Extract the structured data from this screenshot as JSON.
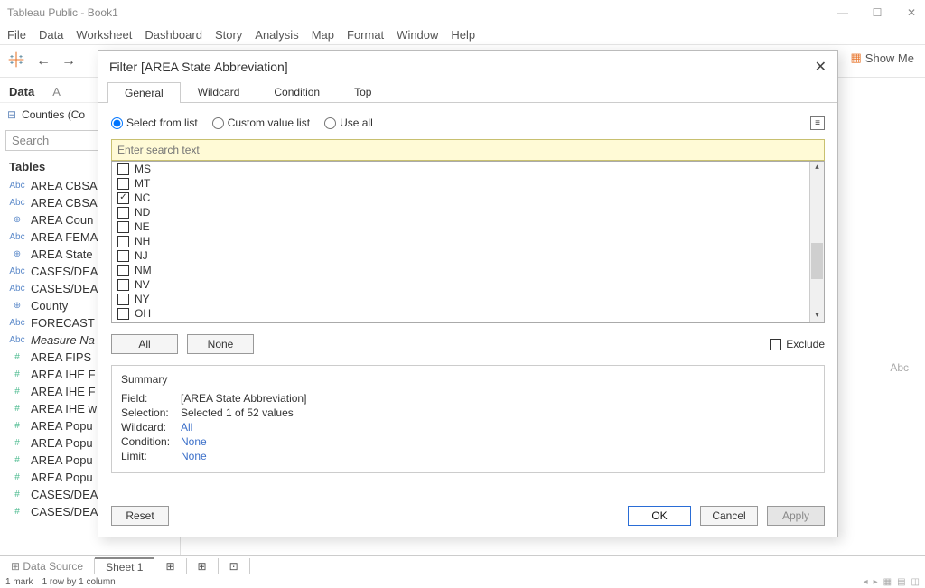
{
  "app": {
    "title": "Tableau Public - Book1"
  },
  "menu": [
    "File",
    "Data",
    "Worksheet",
    "Dashboard",
    "Story",
    "Analysis",
    "Map",
    "Format",
    "Window",
    "Help"
  ],
  "showme": "Show Me",
  "datapane": {
    "tab_data": "Data",
    "tab_analytics_initial": "A",
    "datasource": "Counties (Co",
    "search_placeholder": "Search",
    "tables_label": "Tables"
  },
  "fields": [
    {
      "type": "Abc",
      "label": "AREA CBSA",
      "measure": false
    },
    {
      "type": "Abc",
      "label": "AREA CBSA",
      "measure": false
    },
    {
      "type": "⊕",
      "label": "AREA Coun",
      "measure": false
    },
    {
      "type": "Abc",
      "label": "AREA FEMA",
      "measure": false
    },
    {
      "type": "⊕",
      "label": "AREA State",
      "measure": false
    },
    {
      "type": "Abc",
      "label": "CASES/DEA",
      "measure": false
    },
    {
      "type": "Abc",
      "label": "CASES/DEA",
      "measure": false
    },
    {
      "type": "⊕",
      "label": "County",
      "measure": false
    },
    {
      "type": "Abc",
      "label": "FORECAST",
      "measure": false
    },
    {
      "type": "Abc",
      "label": "Measure Na",
      "measure": false,
      "italic": true
    },
    {
      "type": "#",
      "label": "AREA FIPS ",
      "measure": true
    },
    {
      "type": "#",
      "label": "AREA IHE F",
      "measure": true
    },
    {
      "type": "#",
      "label": "AREA IHE F",
      "measure": true
    },
    {
      "type": "#",
      "label": "AREA IHE w",
      "measure": true
    },
    {
      "type": "#",
      "label": "AREA Popu",
      "measure": true
    },
    {
      "type": "#",
      "label": "AREA Popu",
      "measure": true
    },
    {
      "type": "#",
      "label": "AREA Popu",
      "measure": true
    },
    {
      "type": "#",
      "label": "AREA Popu",
      "measure": true
    },
    {
      "type": "#",
      "label": "CASES/DEA",
      "measure": true
    },
    {
      "type": "#",
      "label": "CASES/DEA",
      "measure": true
    }
  ],
  "bottom": {
    "datasource_tab": "Data Source",
    "sheet_tab": "Sheet 1"
  },
  "status": {
    "marks": "1 mark",
    "rows": "1 row by 1 column"
  },
  "abc_placeholder": "Abc",
  "dialog": {
    "title": "Filter [AREA State Abbreviation]",
    "tabs": [
      "General",
      "Wildcard",
      "Condition",
      "Top"
    ],
    "radios": {
      "select": "Select from list",
      "custom": "Custom value list",
      "useall": "Use all"
    },
    "search_placeholder": "Enter search text",
    "items": [
      {
        "label": "MS",
        "checked": false
      },
      {
        "label": "MT",
        "checked": false
      },
      {
        "label": "NC",
        "checked": true
      },
      {
        "label": "ND",
        "checked": false
      },
      {
        "label": "NE",
        "checked": false
      },
      {
        "label": "NH",
        "checked": false
      },
      {
        "label": "NJ",
        "checked": false
      },
      {
        "label": "NM",
        "checked": false
      },
      {
        "label": "NV",
        "checked": false
      },
      {
        "label": "NY",
        "checked": false
      },
      {
        "label": "OH",
        "checked": false
      }
    ],
    "btn_all": "All",
    "btn_none": "None",
    "exclude": "Exclude",
    "summary": {
      "title": "Summary",
      "field_l": "Field:",
      "field_v": "[AREA State Abbreviation]",
      "selection_l": "Selection:",
      "selection_v": "Selected 1 of 52 values",
      "wildcard_l": "Wildcard:",
      "wildcard_v": "All",
      "condition_l": "Condition:",
      "condition_v": "None",
      "limit_l": "Limit:",
      "limit_v": "None"
    },
    "btn_reset": "Reset",
    "btn_ok": "OK",
    "btn_cancel": "Cancel",
    "btn_apply": "Apply"
  }
}
